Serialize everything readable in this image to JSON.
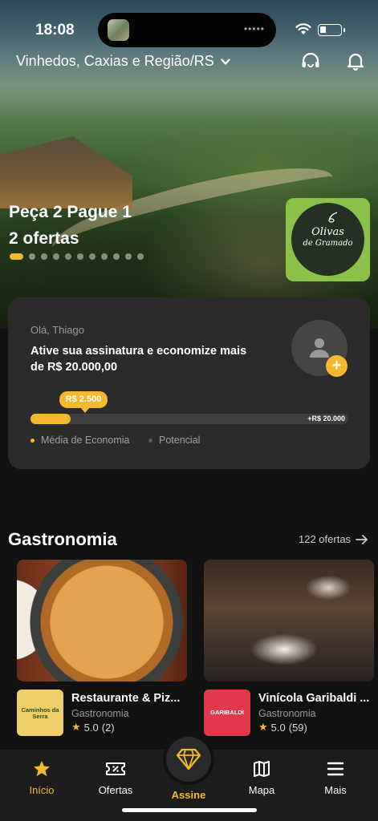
{
  "status_bar": {
    "time": "18:08",
    "island_dots": "•••••"
  },
  "header": {
    "region": "Vinhedos, Caxias e Região/RS"
  },
  "hero": {
    "title": "Peça 2 Pague 1",
    "subtitle": "2 ofertas",
    "carousel_count": 11,
    "carousel_active_index": 0,
    "partner_logo_text_line1": "Olivas",
    "partner_logo_text_line2": "de Gramado"
  },
  "savings": {
    "greeting": "Olá, Thiago",
    "cta": "Ative sua assinatura e economize mais de  R$ 20.000,00",
    "bubble_value": "R$ 2.500",
    "max_value": "+R$ 20.000",
    "progress_fraction": 0.125,
    "avatar_add": "+",
    "legend": [
      {
        "label": "Média de Economia",
        "color": "#f5b82e"
      },
      {
        "label": "Potencial",
        "color": "#5a5a5a"
      }
    ]
  },
  "section": {
    "title": "Gastronomia",
    "link": "122 ofertas",
    "offers": [
      {
        "name": "Restaurante & Piz...",
        "category": "Gastronomia",
        "rating": "5.0",
        "reviews": "(2)",
        "logo_text": "Caminhos da Serra"
      },
      {
        "name": "Vinícola Garibaldi ...",
        "category": "Gastronomia",
        "rating": "5.0",
        "reviews": "(59)",
        "logo_text": "GARIBALDI"
      }
    ]
  },
  "tabs": [
    {
      "label": "Início",
      "icon": "star-icon",
      "active": true
    },
    {
      "label": "Ofertas",
      "icon": "ticket-icon",
      "active": false
    },
    {
      "label": "Assine",
      "icon": "diamond-icon",
      "active": false
    },
    {
      "label": "Mapa",
      "icon": "map-icon",
      "active": false
    },
    {
      "label": "Mais",
      "icon": "menu-icon",
      "active": false
    }
  ],
  "colors": {
    "accent": "#f5b82e",
    "background": "#111111",
    "card": "#2b2b2b",
    "partner_green": "#8ac249"
  }
}
